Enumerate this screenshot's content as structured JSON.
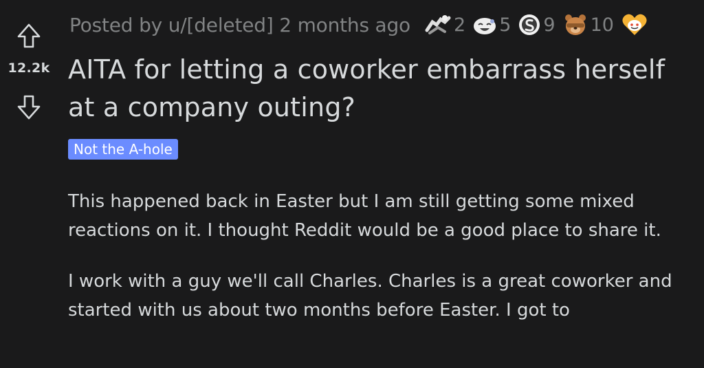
{
  "post": {
    "score": "12.2k",
    "meta_prefix": "Posted by",
    "author": "u/[deleted]",
    "age": "2 months ago",
    "awards": [
      {
        "icon": "handshake-award-icon",
        "count": "2"
      },
      {
        "icon": "laughing-award-icon",
        "count": "5"
      },
      {
        "icon": "silver-coin-award-icon",
        "count": "9"
      },
      {
        "icon": "bear-facepalm-award-icon",
        "count": "10"
      },
      {
        "icon": "heart-snoo-award-icon",
        "count": ""
      }
    ],
    "title": "AITA for letting a coworker embarrass herself at a company outing?",
    "flair": "Not the A-hole",
    "paragraphs": [
      "This happened back in Easter but I am still getting some mixed reactions on it. I thought Reddit would be a good place to share it.",
      "I work with a guy we'll call Charles. Charles is a great coworker and started with us about two months before Easter. I got to"
    ]
  },
  "colors": {
    "background": "#1a1a1b",
    "text": "#d7dadc",
    "muted": "#818384",
    "flair_bg": "#6b8cff"
  }
}
